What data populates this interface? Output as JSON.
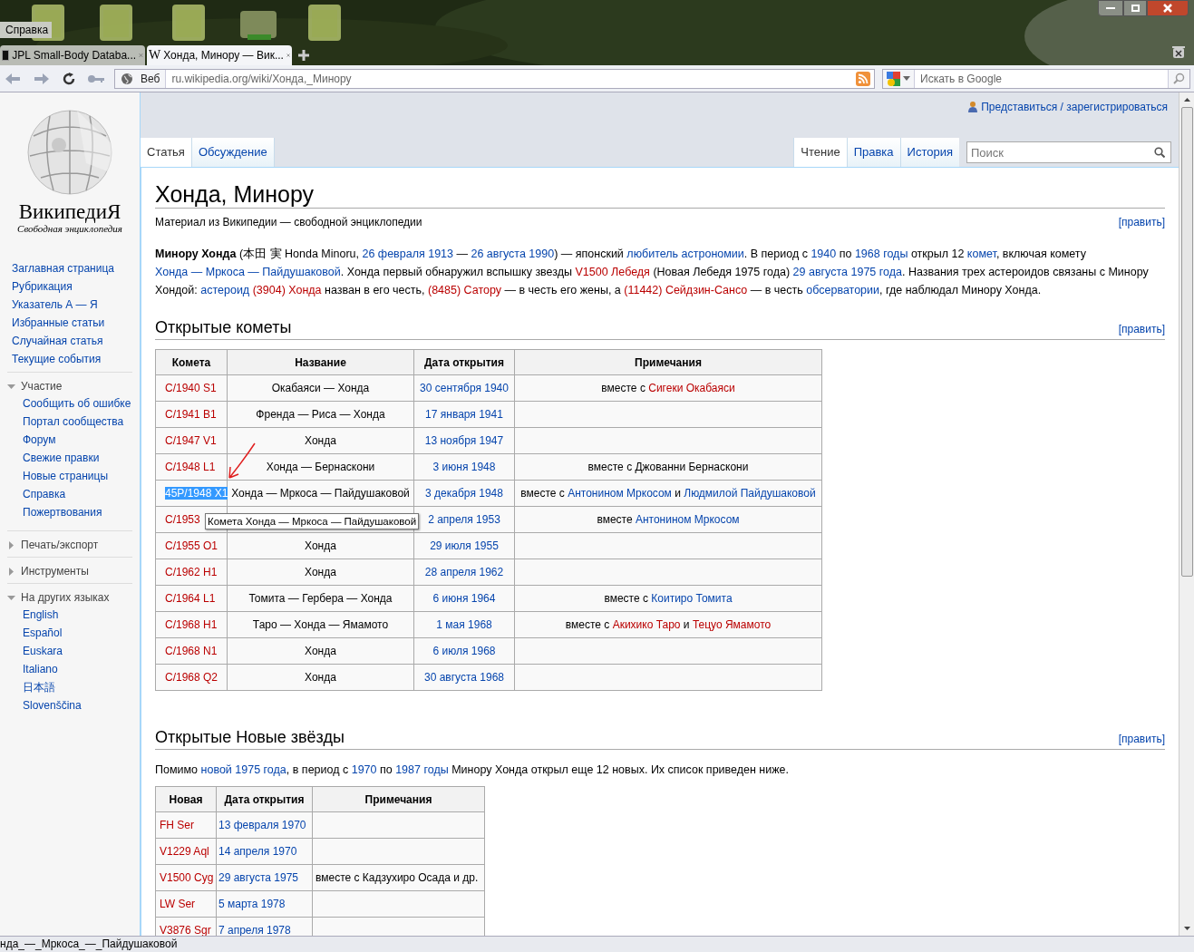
{
  "desktop": {
    "menu_item": "Справка"
  },
  "browser": {
    "tabs": [
      {
        "title": "JPL Small-Body Databa...",
        "selected": false
      },
      {
        "title": "Хонда, Минору — Вик...",
        "selected": true,
        "favicon": "W"
      }
    ],
    "address": {
      "scope": "Веб",
      "url": "ru.wikipedia.org/wiki/Хонда,_Минору"
    },
    "search": {
      "placeholder": "Искать в Google"
    },
    "status_bar": "нда_—_Мркоса_—_Пайдушаковой"
  },
  "wiki": {
    "logo": {
      "wordmark": "ВикипедиЯ",
      "tagline": "Свободная энциклопедия"
    },
    "personal": "Представиться / зарегистрироваться",
    "namespaces": [
      {
        "label": "Статья",
        "selected": true
      },
      {
        "label": "Обсуждение",
        "selected": false
      }
    ],
    "views": [
      {
        "label": "Чтение",
        "selected": true
      },
      {
        "label": "Правка",
        "selected": false
      },
      {
        "label": "История",
        "selected": false
      }
    ],
    "search_placeholder": "Поиск",
    "sidebar": {
      "links": [
        "Заглавная страница",
        "Рубрикация",
        "Указатель А — Я",
        "Избранные статьи",
        "Случайная статья",
        "Текущие события"
      ],
      "portals": [
        {
          "title": "Участие",
          "expanded": true,
          "links": [
            "Сообщить об ошибке",
            "Портал сообщества",
            "Форум",
            "Свежие правки",
            "Новые страницы",
            "Справка",
            "Пожертвования"
          ]
        },
        {
          "title": "Печать/экспорт",
          "expanded": false
        },
        {
          "title": "Инструменты",
          "expanded": false
        },
        {
          "title": "На других языках",
          "expanded": true,
          "links": [
            "English",
            "Español",
            "Euskara",
            "Italiano",
            "日本語",
            "Slovenščina"
          ]
        }
      ]
    },
    "title": "Хонда, Минору",
    "tagline": "Материал из Википедии — свободной энциклопедии",
    "edit_link": "[править]",
    "intro": [
      {
        "kind": "bold",
        "text": "Минору Хонда"
      },
      {
        "kind": "text",
        "text": " (本田 実 Honda Minoru, "
      },
      {
        "kind": "link",
        "text": "26 февраля 1913"
      },
      {
        "kind": "text",
        "text": " — "
      },
      {
        "kind": "link",
        "text": "26 августа 1990"
      },
      {
        "kind": "text",
        "text": ") — японский "
      },
      {
        "kind": "link",
        "text": "любитель астрономии"
      },
      {
        "kind": "text",
        "text": ". В период с "
      },
      {
        "kind": "link",
        "text": "1940"
      },
      {
        "kind": "text",
        "text": " по "
      },
      {
        "kind": "link",
        "text": "1968 годы"
      },
      {
        "kind": "text",
        "text": " открыл 12 "
      },
      {
        "kind": "link",
        "text": "комет"
      },
      {
        "kind": "text",
        "text": ", включая комету "
      },
      {
        "kind": "link",
        "text": "Хонда — Мркоса — Пайдушаковой"
      },
      {
        "kind": "text",
        "text": ". Хонда первый обнаружил вспышку звезды "
      },
      {
        "kind": "new",
        "text": "V1500 Лебедя"
      },
      {
        "kind": "text",
        "text": " (Новая Лебедя 1975 года) "
      },
      {
        "kind": "link",
        "text": "29 августа 1975 года"
      },
      {
        "kind": "text",
        "text": ". Названия трех астероидов связаны с Минору Хондой: "
      },
      {
        "kind": "link",
        "text": "астероид",
        "gap_after": true
      },
      {
        "kind": "new",
        "text": "(3904) Хонда"
      },
      {
        "kind": "text",
        "text": " назван в его честь, "
      },
      {
        "kind": "new",
        "text": "(8485) Сатору"
      },
      {
        "kind": "text",
        "text": " — в честь его жены, а "
      },
      {
        "kind": "new",
        "text": "(11442) Сейдзин-Сансо"
      },
      {
        "kind": "text",
        "text": " — в честь "
      },
      {
        "kind": "link",
        "text": "обсерватории"
      },
      {
        "kind": "text",
        "text": ", где наблюдал Минору Хонда."
      }
    ],
    "comets": {
      "heading": "Открытые кометы",
      "edit": "[править]",
      "columns": [
        "Комета",
        "Название",
        "Дата открытия",
        "Примечания"
      ],
      "rows": [
        {
          "comet": "C/1940 S1",
          "highlighted": false,
          "name": "Окабаяси — Хонда",
          "date": "30 сентября 1940",
          "notes": [
            {
              "kind": "text",
              "text": "вместе с "
            },
            {
              "kind": "new",
              "text": "Сигеки Окабаяси"
            }
          ]
        },
        {
          "comet": "C/1941 B1",
          "highlighted": false,
          "name": "Френда — Риса — Хонда",
          "date": "17 января 1941"
        },
        {
          "comet": "C/1947 V1",
          "highlighted": false,
          "name": "Хонда",
          "date": "13 ноября 1947"
        },
        {
          "comet": "C/1948 L1",
          "highlighted": false,
          "name": "Хонда — Бернаскони",
          "date": "3 июня 1948",
          "notes": [
            {
              "kind": "text",
              "text": "вместе с Джованни Бернаскони"
            }
          ]
        },
        {
          "comet": "45P/1948 X1",
          "highlighted": true,
          "name": "Хонда — Мркоса — Пайдушаковой",
          "date": "3 декабря 1948",
          "notes": [
            {
              "kind": "text",
              "text": "вместе с "
            },
            {
              "kind": "link",
              "text": "Антонином Мркосом"
            },
            {
              "kind": "text",
              "text": " и "
            },
            {
              "kind": "link",
              "text": "Людмилой Пайдушаковой"
            }
          ]
        },
        {
          "comet": "C/1953",
          "highlighted": false,
          "tooltip": "Комета Хонда — Мркоса — Пайдушаковой",
          "date": "2 апреля 1953",
          "notes": [
            {
              "kind": "text",
              "text": "вместе "
            },
            {
              "kind": "link",
              "text": "Антонином Мркосом"
            }
          ]
        },
        {
          "comet": "C/1955 O1",
          "highlighted": false,
          "name": "Хонда",
          "date": "29 июля 1955"
        },
        {
          "comet": "C/1962 H1",
          "highlighted": false,
          "name": "Хонда",
          "date": "28 апреля 1962"
        },
        {
          "comet": "C/1964 L1",
          "highlighted": false,
          "name": "Томита — Гербера — Хонда",
          "date": "6 июня 1964",
          "notes": [
            {
              "kind": "text",
              "text": "вместе с "
            },
            {
              "kind": "link",
              "text": "Коитиро Томита"
            }
          ]
        },
        {
          "comet": "C/1968 H1",
          "highlighted": false,
          "name": "Таро — Хонда — Ямамото",
          "date": "1 мая 1968",
          "notes": [
            {
              "kind": "text",
              "text": "вместе с "
            },
            {
              "kind": "new",
              "text": "Акихико Таро"
            },
            {
              "kind": "text",
              "text": " и "
            },
            {
              "kind": "new",
              "text": "Тецуо Ямамото"
            }
          ]
        },
        {
          "comet": "C/1968 N1",
          "highlighted": false,
          "name": "Хонда",
          "date": "6 июля 1968"
        },
        {
          "comet": "C/1968 Q2",
          "highlighted": false,
          "name": "Хонда",
          "date": "30 августа 1968"
        }
      ]
    },
    "novae": {
      "heading": "Открытые Новые звёзды",
      "edit": "[править]",
      "paragraph": [
        {
          "kind": "text",
          "text": "Помимо "
        },
        {
          "kind": "link",
          "text": "новой 1975 года"
        },
        {
          "kind": "text",
          "text": ", в период с "
        },
        {
          "kind": "link",
          "text": "1970"
        },
        {
          "kind": "text",
          "text": " по "
        },
        {
          "kind": "link",
          "text": "1987 годы"
        },
        {
          "kind": "text",
          "text": " Минору Хонда открыл еще 12 новых. Их список приведен ниже."
        }
      ],
      "columns": [
        "Новая",
        "Дата открытия",
        "Примечания"
      ],
      "rows": [
        {
          "nova": "FH Ser",
          "date": "13 февраля 1970"
        },
        {
          "nova": "V1229 Aql",
          "date": "14 апреля 1970"
        },
        {
          "nova": "V1500 Cyg",
          "date": "29 августа 1975",
          "notes": [
            {
              "kind": "text",
              "text": "вместе с Кадзухиро Осада и др."
            }
          ]
        },
        {
          "nova": "LW Ser",
          "date": "5 марта 1978"
        },
        {
          "nova": "V3876 Sgr",
          "date": "7 апреля 1978"
        }
      ]
    }
  }
}
